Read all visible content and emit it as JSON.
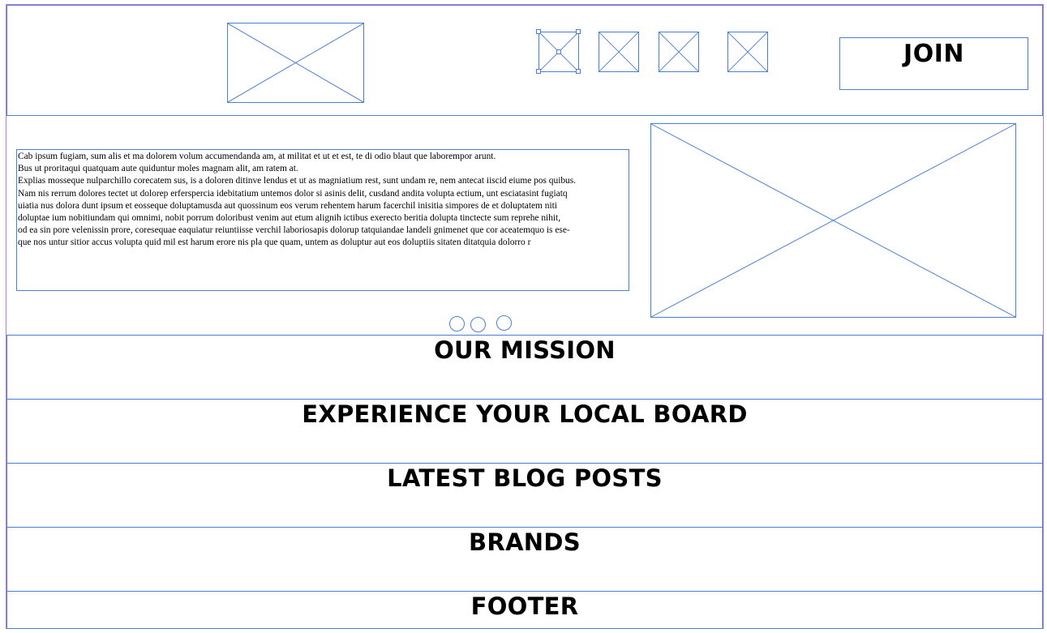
{
  "header": {
    "join_label": "JOIN",
    "logo_icon": "image-placeholder-icon",
    "social_icons": [
      "image-placeholder-icon",
      "image-placeholder-icon",
      "image-placeholder-icon",
      "image-placeholder-icon"
    ]
  },
  "hero": {
    "paragraphs": [
      "Cab ipsum fugiam, sum alis et ma dolorem volum accumendanda am, at militat et ut et est, te di odio blaut que laborempor arunt.",
      "Bus ut proritaqui quatquam aute quiduntur moles magnam alit, am ratem at.",
      "Explias mosseque nulparchillo corecatem sus, is a doloren ditinve lendus et ut as magniatium rest, sunt undam re, nem antecat iiscid eiume pos quibus.",
      "Nam nis rerrum dolores tectet ut dolorep erferspercia idebitatium untemos dolor si asinis delit, cusdand andita volupta ectium, unt esciatasint fugiatq",
      "uiatia nus dolora dunt ipsum et eosseque doluptamusda aut quossinum eos verum rehentem harum facerchil inisitia simpores de et doluptatem niti",
      "doluptae ium nobitiundam qui omnimi, nobit porrum doloribust venim aut etum alignih ictibus exerecto beritia dolupta tinctecte sum reprehe nihit,",
      "od ea sin pore velenissin prore, coresequae eaquiatur reiuntiisse verchil laboriosapis dolorup tatquiandae landeli gnimenet que cor aceatemquo is ese-",
      "que nos untur sitior accus volupta quid mil est harum erore nis pla que quam, untem as doluptur aut eos doluptiis sitaten ditatquia dolorro r"
    ],
    "image_icon": "image-placeholder-icon",
    "carousel_dots": 3
  },
  "sections": {
    "mission": "OUR MISSION",
    "local_board": "EXPERIENCE YOUR LOCAL BOARD",
    "blog": "LATEST BLOG POSTS",
    "brands": "BRANDS",
    "footer": "FOOTER"
  },
  "colors": {
    "wireframe_blue": "#4a7fd6",
    "page_outline": "#c37ad8"
  }
}
